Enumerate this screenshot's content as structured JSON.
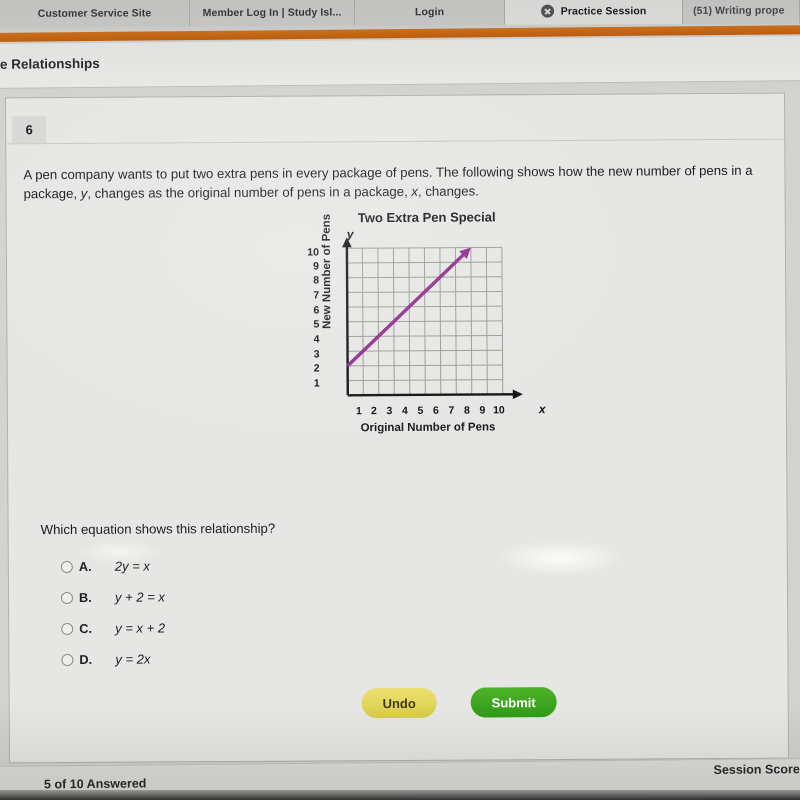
{
  "browser": {
    "tabs": [
      {
        "label": "Customer Service Site",
        "active": false,
        "has_close": false
      },
      {
        "label": "Member Log In | Study Isl...",
        "active": false,
        "has_close": false
      },
      {
        "label": "Login",
        "active": false,
        "has_close": false
      },
      {
        "label": "Practice Session",
        "active": true,
        "has_close": true
      },
      {
        "label": "(51) Writing prope",
        "active": false,
        "has_close": false
      }
    ],
    "accent_color": "#c8661a"
  },
  "header": {
    "title": "e Relationships"
  },
  "question": {
    "number": "6",
    "stem_part1": "A pen company wants to put two extra pens in every package of pens. The following shows how the new number of pens in a package, ",
    "stem_y": "y",
    "stem_part2": ", changes as the original number of pens in a package, ",
    "stem_x": "x",
    "stem_part3": ", changes.",
    "prompt": "Which equation shows this relationship?",
    "options": [
      {
        "letter": "A.",
        "text": "2y = x",
        "selected": false
      },
      {
        "letter": "B.",
        "text": "y + 2 = x",
        "selected": false
      },
      {
        "letter": "C.",
        "text": "y = x + 2",
        "selected": false
      },
      {
        "letter": "D.",
        "text": "y = 2x",
        "selected": false
      }
    ]
  },
  "chart_data": {
    "type": "line",
    "title": "Two Extra Pen Special",
    "xlabel": "Original Number of Pens",
    "ylabel": "New Number of Pens",
    "x_axis_symbol": "x",
    "y_axis_symbol": "y",
    "xlim": [
      0,
      10
    ],
    "ylim": [
      0,
      10
    ],
    "xticks": [
      1,
      2,
      3,
      4,
      5,
      6,
      7,
      8,
      9,
      10
    ],
    "yticks": [
      1,
      2,
      3,
      4,
      5,
      6,
      7,
      8,
      9,
      10
    ],
    "grid": true,
    "legend": "none",
    "line_color": "#8f2b8f",
    "series": [
      {
        "name": "y = x + 2",
        "points": [
          [
            0,
            2
          ],
          [
            8,
            10
          ]
        ],
        "arrow_end": true,
        "equation": "y = x + 2",
        "slope": 1,
        "intercept": 2
      }
    ]
  },
  "actions": {
    "undo_label": "Undo",
    "submit_label": "Submit",
    "undo_color": "#e0d45a",
    "submit_color": "#3ba41e"
  },
  "footer": {
    "answered": "5 of 10 Answered",
    "session_score": "Session Score:"
  }
}
